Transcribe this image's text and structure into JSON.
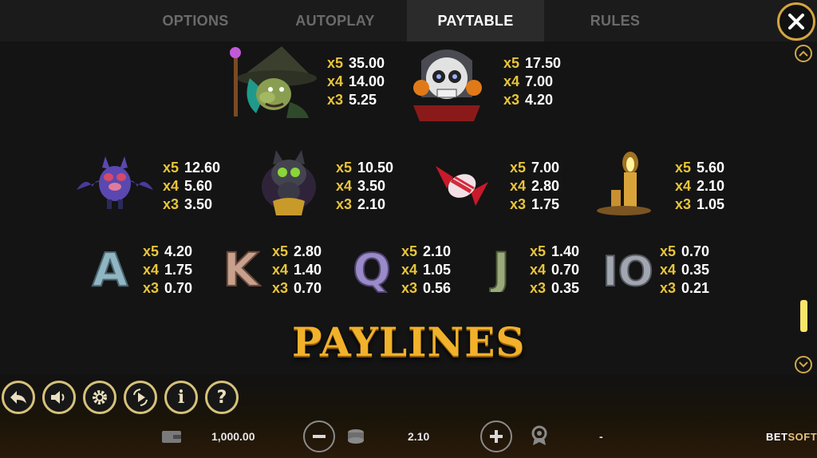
{
  "tabs": [
    {
      "label": "OPTIONS",
      "active": false
    },
    {
      "label": "AUTOPLAY",
      "active": false
    },
    {
      "label": "PAYTABLE",
      "active": true
    },
    {
      "label": "RULES",
      "active": false
    }
  ],
  "paytable": {
    "witch": [
      {
        "mult": "x5",
        "value": "35.00"
      },
      {
        "mult": "x4",
        "value": "14.00"
      },
      {
        "mult": "x3",
        "value": "5.25"
      }
    ],
    "skull": [
      {
        "mult": "x5",
        "value": "17.50"
      },
      {
        "mult": "x4",
        "value": "7.00"
      },
      {
        "mult": "x3",
        "value": "4.20"
      }
    ],
    "bat": [
      {
        "mult": "x5",
        "value": "12.60"
      },
      {
        "mult": "x4",
        "value": "5.60"
      },
      {
        "mult": "x3",
        "value": "3.50"
      }
    ],
    "cat": [
      {
        "mult": "x5",
        "value": "10.50"
      },
      {
        "mult": "x4",
        "value": "3.50"
      },
      {
        "mult": "x3",
        "value": "2.10"
      }
    ],
    "candy": [
      {
        "mult": "x5",
        "value": "7.00"
      },
      {
        "mult": "x4",
        "value": "2.80"
      },
      {
        "mult": "x3",
        "value": "1.75"
      }
    ],
    "candle": [
      {
        "mult": "x5",
        "value": "5.60"
      },
      {
        "mult": "x4",
        "value": "2.10"
      },
      {
        "mult": "x3",
        "value": "1.05"
      }
    ],
    "A": [
      {
        "mult": "x5",
        "value": "4.20"
      },
      {
        "mult": "x4",
        "value": "1.75"
      },
      {
        "mult": "x3",
        "value": "0.70"
      }
    ],
    "K": [
      {
        "mult": "x5",
        "value": "2.80"
      },
      {
        "mult": "x4",
        "value": "1.40"
      },
      {
        "mult": "x3",
        "value": "0.70"
      }
    ],
    "Q": [
      {
        "mult": "x5",
        "value": "2.10"
      },
      {
        "mult": "x4",
        "value": "1.05"
      },
      {
        "mult": "x3",
        "value": "0.56"
      }
    ],
    "J": [
      {
        "mult": "x5",
        "value": "1.40"
      },
      {
        "mult": "x4",
        "value": "0.70"
      },
      {
        "mult": "x3",
        "value": "0.35"
      }
    ],
    "10": [
      {
        "mult": "x5",
        "value": "0.70"
      },
      {
        "mult": "x4",
        "value": "0.35"
      },
      {
        "mult": "x3",
        "value": "0.21"
      }
    ]
  },
  "letters": {
    "A": "A",
    "K": "K",
    "Q": "Q",
    "J": "J",
    "ten": "IO"
  },
  "section_title": "PAYLINES",
  "scroll_position": 0.82,
  "bottom": {
    "balance": "1,000.00",
    "bet": "2.10",
    "win": "-",
    "info_label": "i",
    "help_label": "?",
    "brand_prefix": "BET",
    "brand_suffix": "SOFT"
  },
  "colors": {
    "accent": "#e8c43a",
    "ring": "#d6c27a",
    "title": "#f2b12a"
  }
}
